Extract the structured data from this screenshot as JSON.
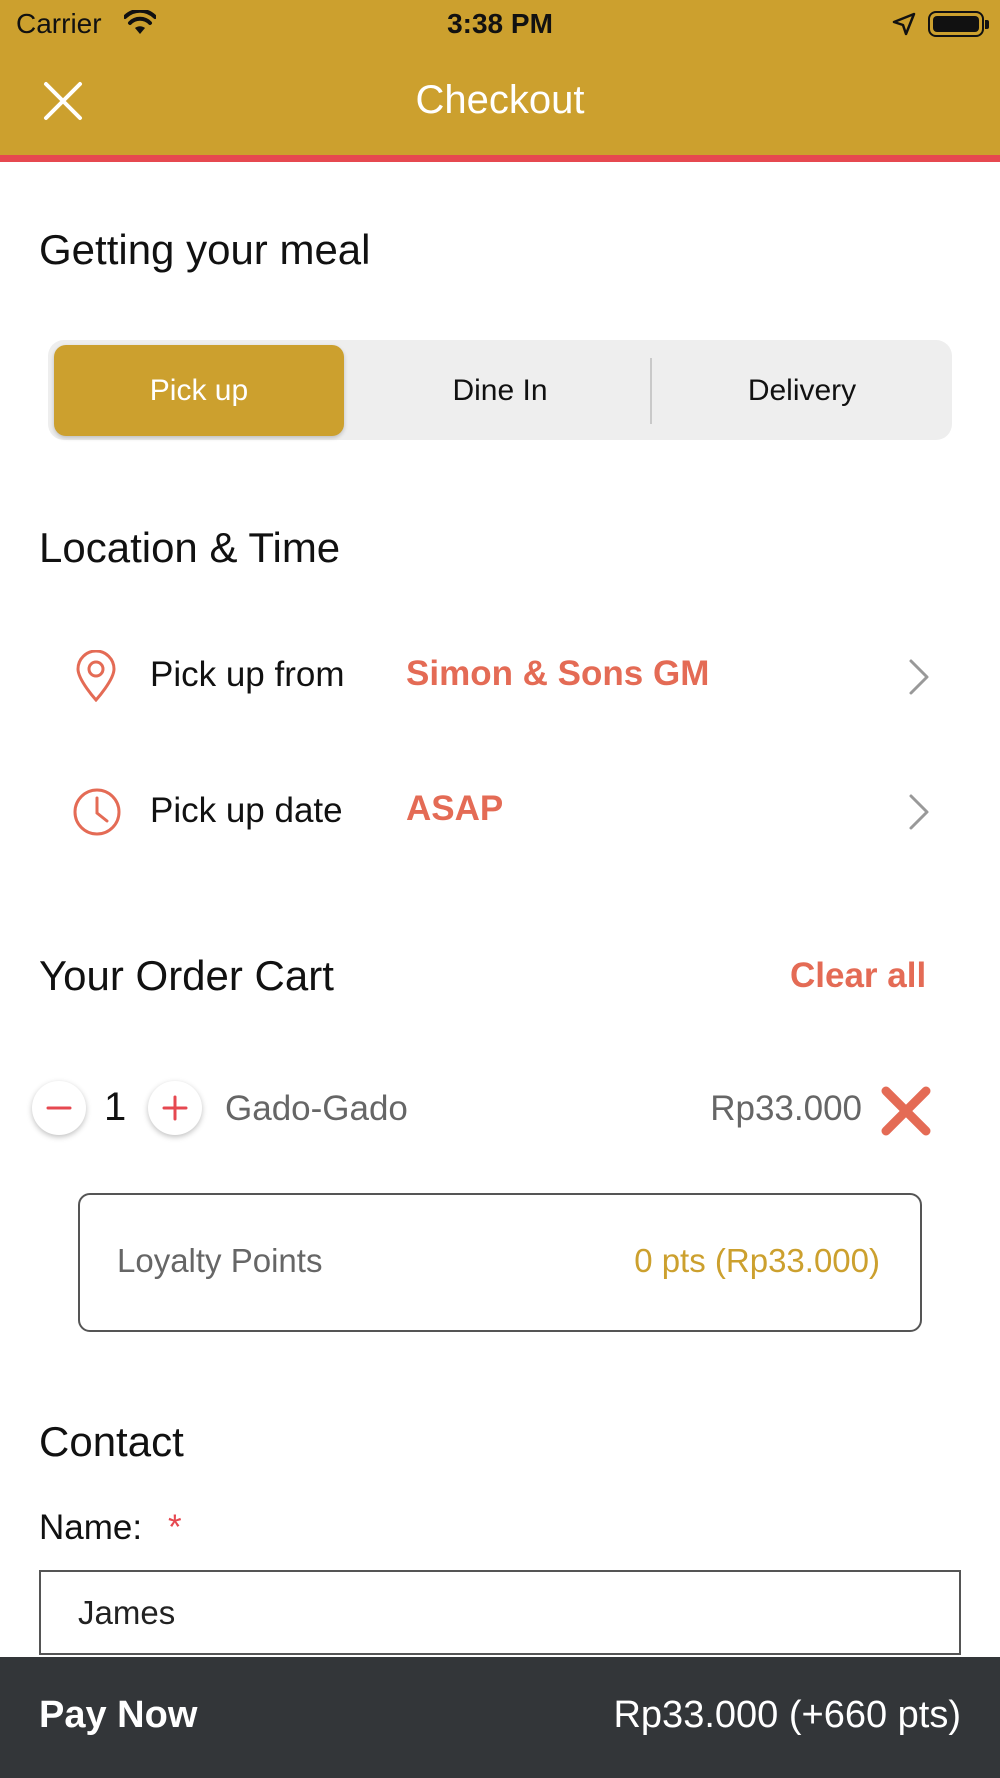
{
  "status_bar": {
    "carrier": "Carrier",
    "time": "3:38 PM"
  },
  "header": {
    "title": "Checkout",
    "accent_color": "#CCA02E",
    "divider_color": "#E64850"
  },
  "meal": {
    "heading": "Getting your meal",
    "options": [
      "Pick up",
      "Dine In",
      "Delivery"
    ],
    "selected": "Pick up"
  },
  "location": {
    "heading": "Location & Time",
    "from_label": "Pick up from",
    "from_value": "Simon & Sons GM",
    "date_label": "Pick up date",
    "date_value": "ASAP"
  },
  "cart": {
    "heading": "Your Order Cart",
    "clear_label": "Clear all",
    "items": [
      {
        "quantity": "1",
        "name": "Gado-Gado",
        "price": "Rp33.000"
      }
    ],
    "loyalty_label": "Loyalty Points",
    "loyalty_value": "0 pts (Rp33.000)"
  },
  "contact": {
    "heading": "Contact",
    "name_label": "Name:",
    "required_mark": "*",
    "name_value": "James"
  },
  "pay": {
    "label": "Pay Now",
    "total": "Rp33.000 (+660 pts)"
  },
  "icons": [
    "close-icon",
    "wifi-icon",
    "location-arrow-icon",
    "battery-icon",
    "map-pin-icon",
    "clock-icon",
    "chevron-right-icon",
    "minus-icon",
    "plus-icon",
    "remove-x-icon"
  ]
}
